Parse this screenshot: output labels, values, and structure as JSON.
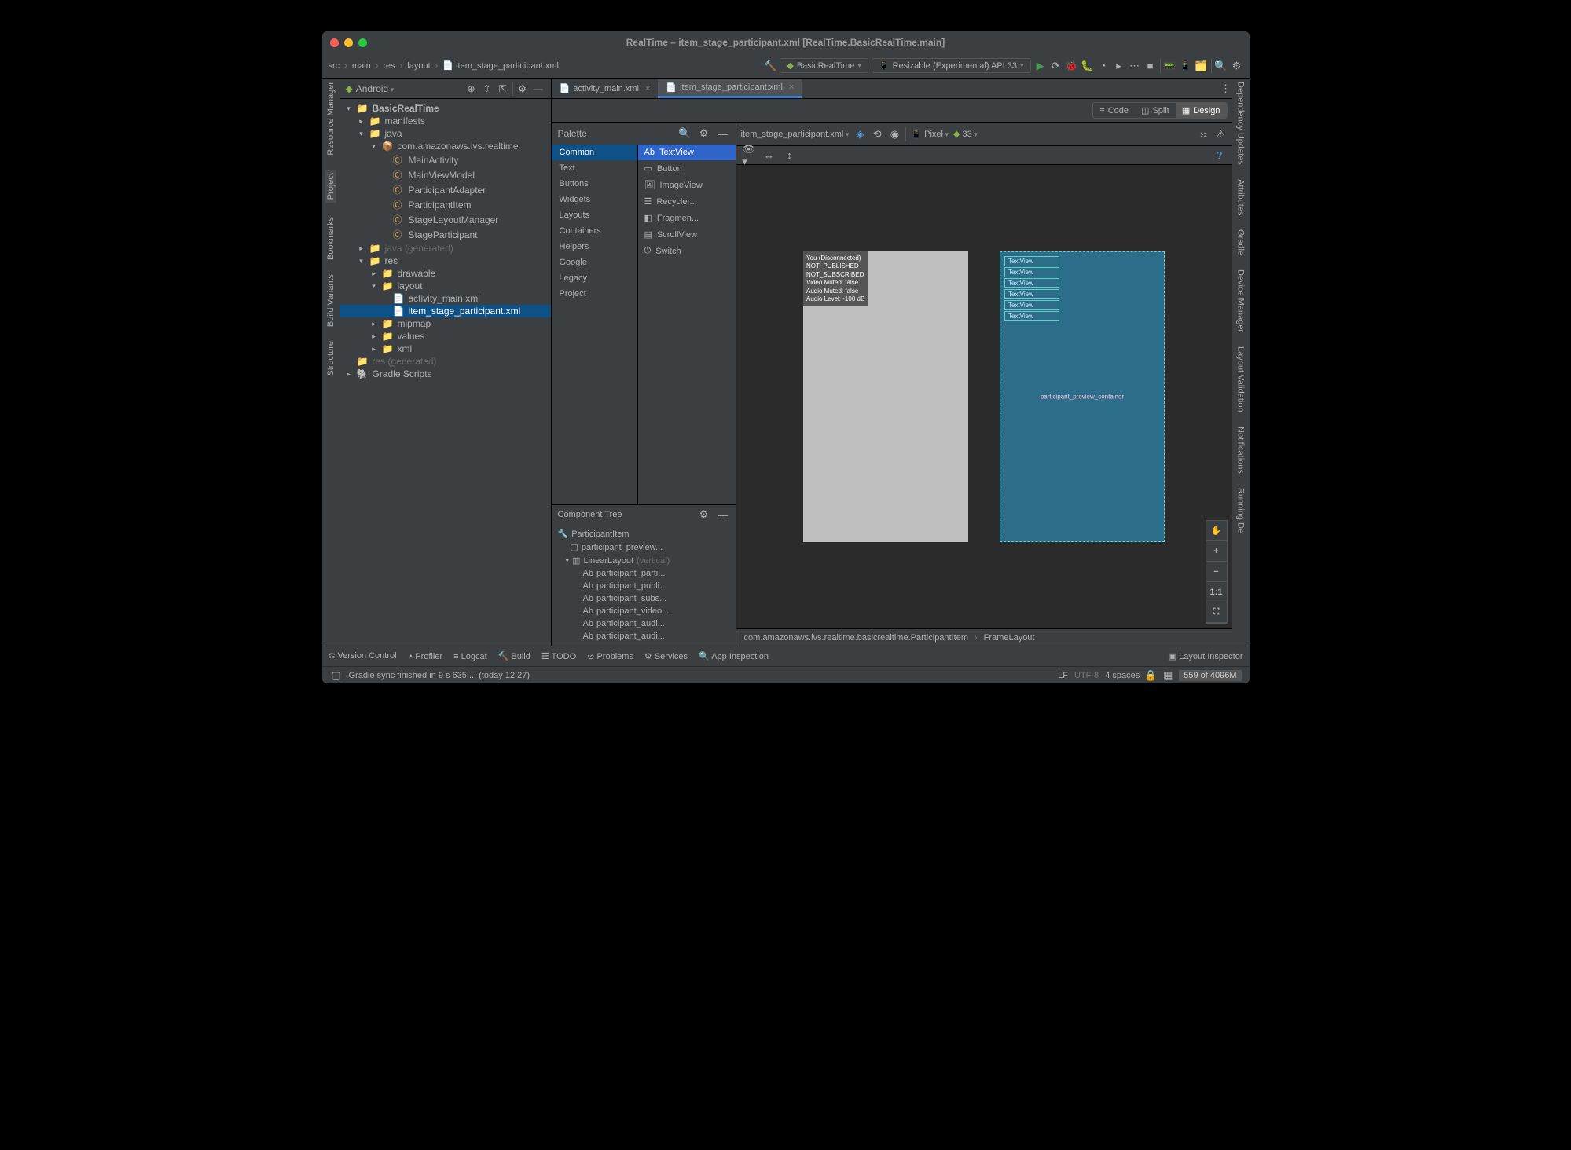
{
  "title": "RealTime – item_stage_participant.xml [RealTime.BasicRealTime.main]",
  "breadcrumb": [
    "src",
    "main",
    "res",
    "layout",
    "item_stage_participant.xml"
  ],
  "runconfig": {
    "app": "BasicRealTime",
    "device": "Resizable (Experimental) API 33"
  },
  "sidebar_header": "Android",
  "project_tree": {
    "root": "BasicRealTime",
    "manifests": "manifests",
    "java": "java",
    "package": "com.amazonaws.ivs.realtime",
    "classes": [
      "MainActivity",
      "MainViewModel",
      "ParticipantAdapter",
      "ParticipantItem",
      "StageLayoutManager",
      "StageParticipant"
    ],
    "java_gen": "java (generated)",
    "res": "res",
    "res_folders": {
      "drawable": "drawable",
      "layout": "layout",
      "layout_files": [
        "activity_main.xml",
        "item_stage_participant.xml"
      ],
      "mipmap": "mipmap",
      "values": "values",
      "xml": "xml"
    },
    "res_gen": "res (generated)",
    "gradle": "Gradle Scripts"
  },
  "tabs": [
    {
      "label": "activity_main.xml",
      "active": false
    },
    {
      "label": "item_stage_participant.xml",
      "active": true
    }
  ],
  "palette": {
    "title": "Palette",
    "categories": [
      "Common",
      "Text",
      "Buttons",
      "Widgets",
      "Layouts",
      "Containers",
      "Helpers",
      "Google",
      "Legacy",
      "Project"
    ],
    "widgets": [
      "TextView",
      "Button",
      "ImageView",
      "Recycler...",
      "Fragmen...",
      "ScrollView",
      "Switch"
    ]
  },
  "component_tree": {
    "title": "Component Tree",
    "root": "ParticipantItem",
    "items": [
      "participant_preview...",
      "LinearLayout",
      "participant_parti...",
      "participant_publi...",
      "participant_subs...",
      "participant_video...",
      "participant_audi...",
      "participant_audi..."
    ],
    "vertical": "(vertical)"
  },
  "design_toolbar": {
    "views": [
      "Code",
      "Split",
      "Design"
    ],
    "file": "item_stage_participant.xml",
    "device": "Pixel",
    "api": "33"
  },
  "preview_lines": [
    "You (Disconnected)",
    "NOT_PUBLISHED",
    "NOT_SUBSCRIBED",
    "Video Muted: false",
    "Audio Muted: false",
    "Audio Level: -100 dB"
  ],
  "blueprint_items": [
    "TextView",
    "TextView",
    "TextView",
    "TextView",
    "TextView",
    "TextView"
  ],
  "blueprint_label": "participant_preview_container",
  "design_breadcrumb": {
    "path": "com.amazonaws.ivs.realtime.basicrealtime.ParticipantItem",
    "child": "FrameLayout"
  },
  "bottom_tabs": [
    "Version Control",
    "Profiler",
    "Logcat",
    "Build",
    "TODO",
    "Problems",
    "Services",
    "App Inspection"
  ],
  "layout_inspector": "Layout Inspector",
  "status": {
    "message": "Gradle sync finished in 9 s 635 ... (today 12:27)",
    "line_ending": "LF",
    "encoding": "UTF-8",
    "indent": "4 spaces",
    "memory": "559 of 4096M"
  },
  "left_rails": [
    "Resource Manager",
    "Project",
    "Bookmarks",
    "Build Variants",
    "Structure"
  ],
  "right_rails": [
    "Dependency Updates",
    "Attributes",
    "Gradle",
    "Device Manager",
    "Layout Validation",
    "Notifications",
    "Running De"
  ]
}
